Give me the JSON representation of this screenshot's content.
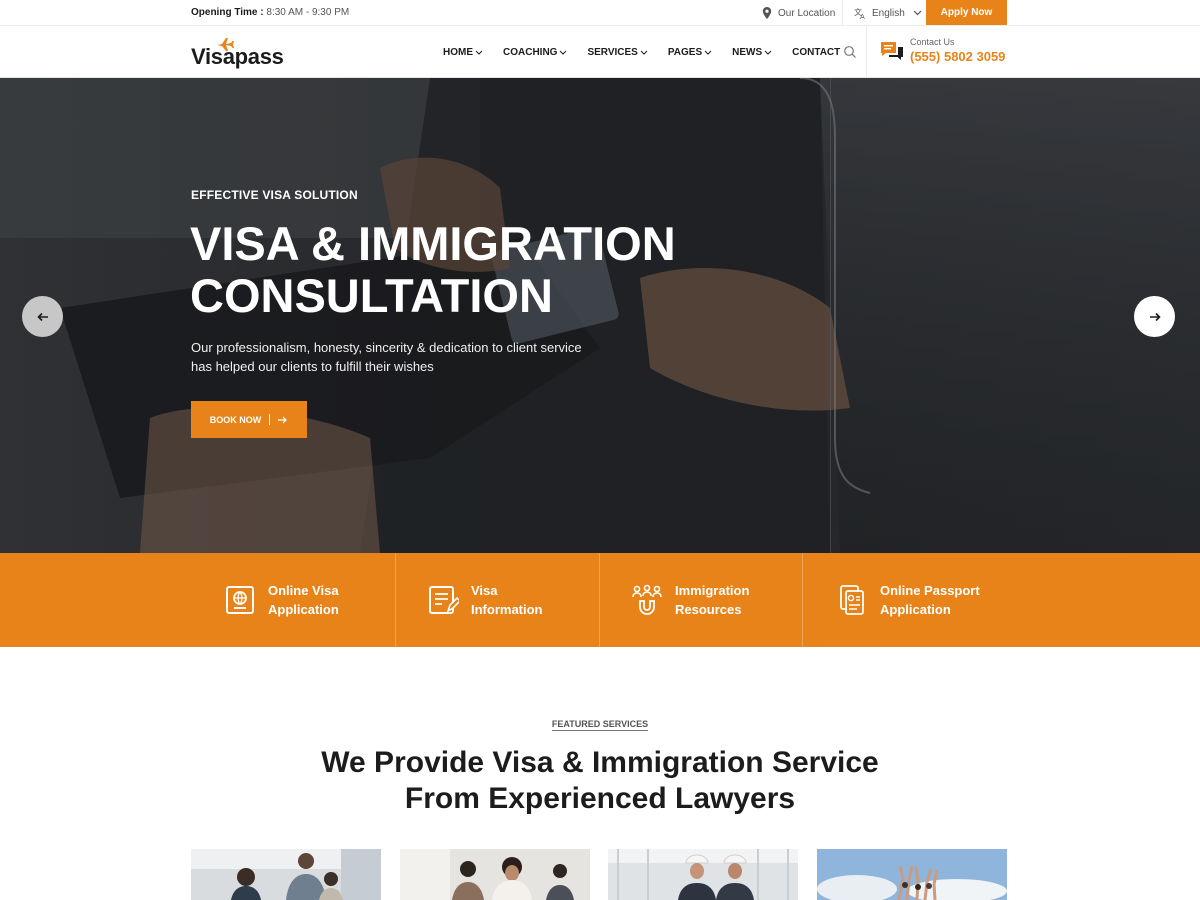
{
  "topbar": {
    "opening_label": "Opening Time :",
    "opening_hours": "8:30 AM - 9:30 PM",
    "location": "Our Location",
    "language": "English",
    "apply": "Apply Now"
  },
  "header": {
    "logo": "Visapass",
    "nav": [
      {
        "label": "HOME",
        "dropdown": true
      },
      {
        "label": "COACHING",
        "dropdown": true
      },
      {
        "label": "SERVICES",
        "dropdown": true
      },
      {
        "label": "PAGES",
        "dropdown": true
      },
      {
        "label": "NEWS",
        "dropdown": true
      },
      {
        "label": "CONTACT",
        "dropdown": false
      }
    ],
    "contact_label": "Contact Us",
    "contact_phone": "(555) 5802 3059"
  },
  "hero": {
    "eyebrow": "EFFECTIVE VISA SOLUTION",
    "title_line1": "VISA & IMMIGRATION",
    "title_line2": "CONSULTATION",
    "desc_line1": "Our professionalism, honesty, sincerity & dedication to client service",
    "desc_line2": "has helped our clients to fulfill their wishes",
    "button": "BOOK NOW"
  },
  "features": [
    {
      "line1": "Online Visa",
      "line2": "Application",
      "icon": "passport-icon"
    },
    {
      "line1": "Visa",
      "line2": "Information",
      "icon": "document-edit-icon"
    },
    {
      "line1": "Immigration",
      "line2": "Resources",
      "icon": "people-magnet-icon"
    },
    {
      "line1": "Online Passport",
      "line2": "Application",
      "icon": "passport-documents-icon"
    }
  ],
  "services": {
    "eyebrow": "FEATURED SERVICES",
    "title_line1": "We Provide Visa & Immigration Service",
    "title_line2": "From Experienced Lawyers"
  },
  "colors": {
    "accent": "#e8831a",
    "dark": "#1c1c1c"
  }
}
